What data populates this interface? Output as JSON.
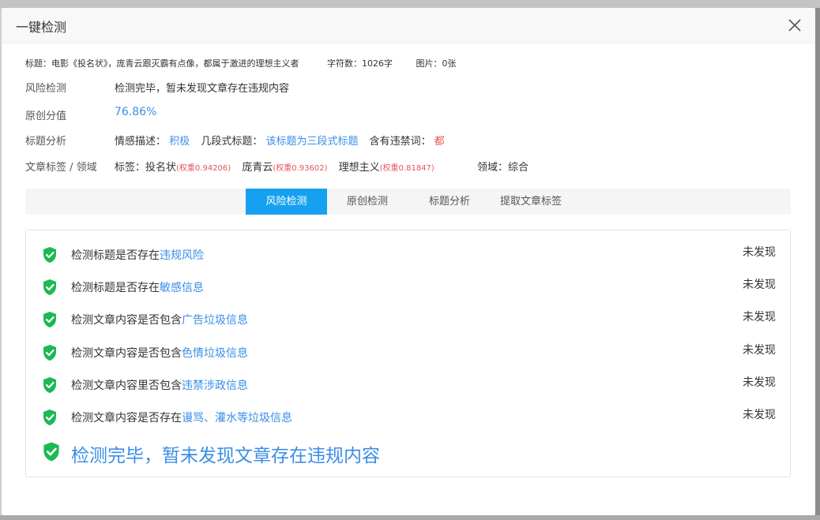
{
  "dialog": {
    "title": "一键检测",
    "close_icon": "close-icon"
  },
  "meta": {
    "title_text": "标题：电影《投名状》，庞青云跟灭霸有点像，都属于激进的理想主义者",
    "char_count": "字符数：1026字",
    "images": "图片：0张"
  },
  "risk": {
    "label": "风险检测",
    "value": "检测完毕，暂未发现文章存在违规内容"
  },
  "originality": {
    "label": "原创分值",
    "value": "76.86%"
  },
  "title_analysis": {
    "label": "标题分析",
    "sentiment_label": "情感描述：",
    "sentiment_value": "积极",
    "segment_label": "几段式标题：",
    "segment_value": "该标题为三段式标题",
    "banned_label": "含有违禁词：",
    "banned_value": "都"
  },
  "tags": {
    "label": "文章标签 / 领域",
    "prefix": "标签：",
    "items": [
      {
        "name": "投名状",
        "weight": "(权重0.94206)"
      },
      {
        "name": "庞青云",
        "weight": "(权重0.93602)"
      },
      {
        "name": "理想主义",
        "weight": "(权重0.81847)"
      }
    ],
    "domain": "领域：综合"
  },
  "tabs": [
    {
      "label": "风险检测",
      "active": true
    },
    {
      "label": "原创检测",
      "active": false
    },
    {
      "label": "标题分析",
      "active": false
    },
    {
      "label": "提取文章标签",
      "active": false
    }
  ],
  "checks": [
    {
      "prefix": "检测标题是否存在",
      "highlight": "违规风险",
      "status": "未发现"
    },
    {
      "prefix": "检测标题是否存在",
      "highlight": "敏感信息",
      "status": "未发现"
    },
    {
      "prefix": "检测文章内容是否包含",
      "highlight": "广告垃圾信息",
      "status": "未发现"
    },
    {
      "prefix": "检测文章内容是否包含",
      "highlight": "色情垃圾信息",
      "status": "未发现"
    },
    {
      "prefix": "检测文章内容里否包含",
      "highlight": "违禁涉政信息",
      "status": "未发现"
    },
    {
      "prefix": "检测文章内容是否存在",
      "highlight": "谩骂、灌水等垃圾信息",
      "status": "未发现"
    }
  ],
  "final_message": "检测完毕，暂未发现文章存在违规内容",
  "colors": {
    "accent": "#3a8ee6",
    "tab_active": "#16a0f0",
    "shield_green": "#1db954",
    "warning_red": "#e45656"
  },
  "icons": {
    "check": "shield-check-icon"
  }
}
